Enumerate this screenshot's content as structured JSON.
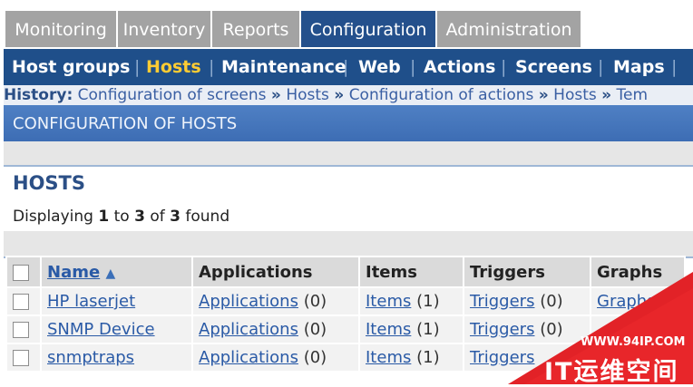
{
  "tabs": [
    "Monitoring",
    "Inventory",
    "Reports",
    "Configuration",
    "Administration"
  ],
  "active_tab": "Configuration",
  "subnav": [
    "Host groups",
    "Hosts",
    "Maintenance",
    "Web",
    "Actions",
    "Screens",
    "Maps"
  ],
  "active_sub": "Hosts",
  "history": {
    "label": "History:",
    "items": [
      "Configuration of screens",
      "Hosts",
      "Configuration of actions",
      "Hosts",
      "Tem"
    ]
  },
  "config_header": "CONFIGURATION OF HOSTS",
  "section_title": "HOSTS",
  "displaying": {
    "prefix": "Displaying",
    "from": "1",
    "to_word": "to",
    "to": "3",
    "of_word": "of",
    "total": "3",
    "suffix": "found"
  },
  "table": {
    "headers": [
      "Name",
      "Applications",
      "Items",
      "Triggers",
      "Graphs"
    ],
    "rows": [
      {
        "name": "HP laserjet",
        "applications": "Applications",
        "app_count": "(0)",
        "items": "Items",
        "items_count": "(1)",
        "triggers": "Triggers",
        "triggers_count": "(0)",
        "graphs": "Graphs"
      },
      {
        "name": "SNMP Device",
        "applications": "Applications",
        "app_count": "(0)",
        "items": "Items",
        "items_count": "(1)",
        "triggers": "Triggers",
        "triggers_count": "(0)",
        "graphs": ""
      },
      {
        "name": "snmptraps",
        "applications": "Applications",
        "app_count": "(0)",
        "items": "Items",
        "items_count": "(1)",
        "triggers": "Triggers",
        "triggers_count": "",
        "graphs": ""
      }
    ]
  },
  "watermark": {
    "url": "WWW.94IP.COM",
    "text": "IT运维空间"
  },
  "colors": {
    "nav_bg": "#1f4f8a",
    "active_sub": "#ffcc33",
    "link": "#2a5aa6",
    "watermark": "#e8262a"
  }
}
